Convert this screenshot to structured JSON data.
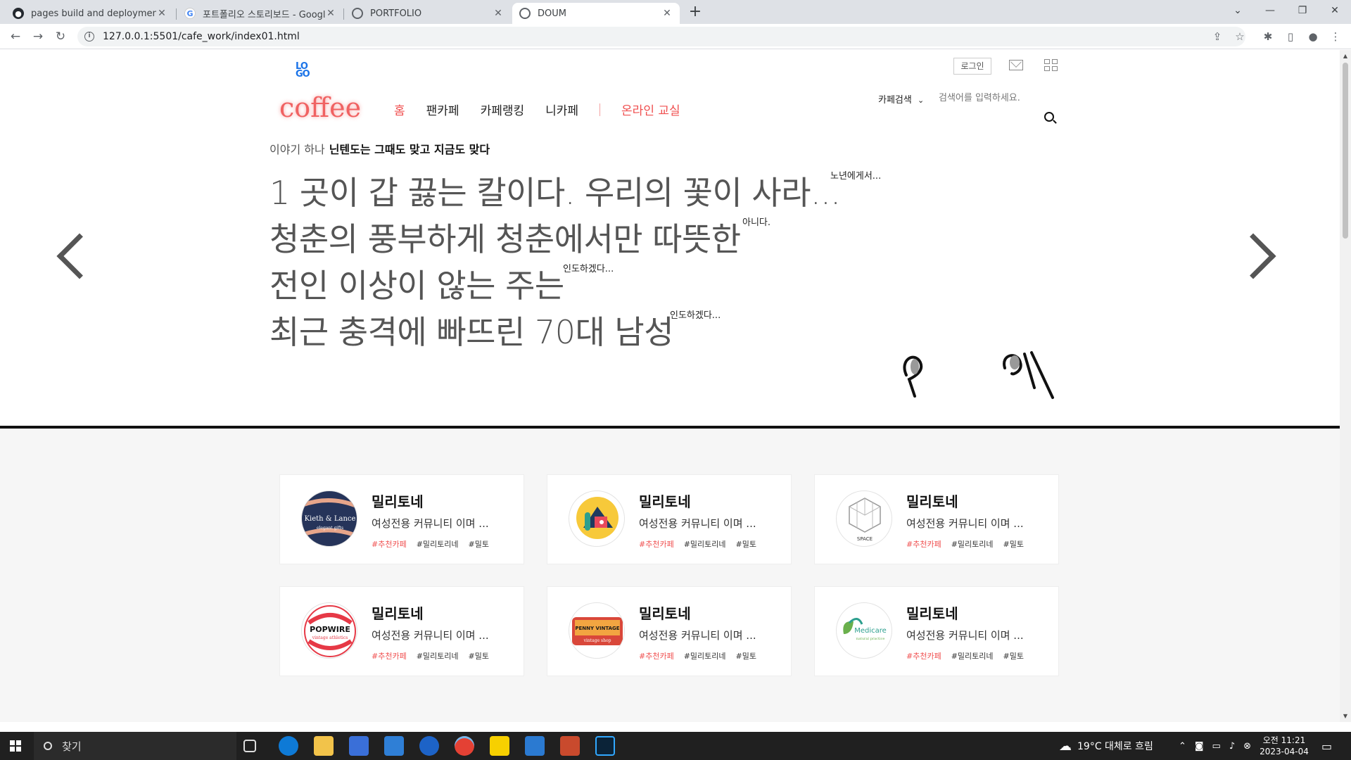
{
  "browser": {
    "tabs": [
      {
        "title": "pages build and deployment · w",
        "active": false,
        "favicon": "github-icon"
      },
      {
        "title": "포트폴리오 스토리보드 - Google",
        "active": false,
        "favicon": "google-icon"
      },
      {
        "title": "PORTFOLIO",
        "active": false,
        "favicon": "globe-icon"
      },
      {
        "title": "DOUM",
        "active": true,
        "favicon": "globe-icon"
      }
    ],
    "url": "127.0.0.1:5501/cafe_work/index01.html"
  },
  "header": {
    "logo_text": "LOGO",
    "brand": "coffee",
    "login_label": "로그인",
    "search_category": "카페검색",
    "search_placeholder": "검색어를 입력하세요."
  },
  "nav": {
    "items": [
      "홈",
      "팬카페",
      "카페랭킹",
      "니카페"
    ],
    "online": "온라인 교실"
  },
  "story": {
    "prefix": "이야기 하나",
    "headline": "닌텐도는 그때도 맞고 지금도 맞다"
  },
  "slides": [
    {
      "text": "1 곳이 갑 끓는 칼이다. 우리의 꽃이 사라...",
      "note": "노년에게서..."
    },
    {
      "text": "청춘의 풍부하게 청춘에서만 따뜻한",
      "note": "아니다."
    },
    {
      "text": "전인 이상이 않는 주는",
      "note": "인도하겠다..."
    },
    {
      "text": "최근 충격에 빠뜨린 70대 남성",
      "note": "인도하겠다..."
    }
  ],
  "cards": [
    {
      "name": "밀리토네",
      "desc": "여성전용 커뮤니티 이며 ...",
      "tags": [
        "#추천카페",
        "#밀리토리네",
        "#밀토"
      ],
      "logo_text": "Kieth & Lance",
      "logo_sub": "elegant gifts",
      "logo_bg": "#26345a"
    },
    {
      "name": "밀리토네",
      "desc": "여성전용 커뮤니티 이며 ...",
      "tags": [
        "#추천카페",
        "#밀리토리네",
        "#밀토"
      ],
      "logo_text": "",
      "logo_sub": "",
      "logo_bg": "#ffffff"
    },
    {
      "name": "밀리토네",
      "desc": "여성전용 커뮤니티 이며 ...",
      "tags": [
        "#추천카페",
        "#밀리토리네",
        "#밀토"
      ],
      "logo_text": "SPACE",
      "logo_sub": "",
      "logo_bg": "#ffffff"
    },
    {
      "name": "밀리토네",
      "desc": "여성전용 커뮤니티 이며 ...",
      "tags": [
        "#추천카페",
        "#밀리토리네",
        "#밀토"
      ],
      "logo_text": "POPWIRE",
      "logo_sub": "vintage athletics",
      "logo_bg": "#ffffff"
    },
    {
      "name": "밀리토네",
      "desc": "여성전용 커뮤니티 이며 ...",
      "tags": [
        "#추천카페",
        "#밀리토리네",
        "#밀토"
      ],
      "logo_text": "PENNY VINTAGE",
      "logo_sub": "vintage shop",
      "logo_bg": "#ffffff"
    },
    {
      "name": "밀리토네",
      "desc": "여성전용 커뮤니티 이며 ...",
      "tags": [
        "#추천카페",
        "#밀리토리네",
        "#밀토"
      ],
      "logo_text": "Medicare",
      "logo_sub": "natural practice",
      "logo_bg": "#ffffff"
    }
  ],
  "taskbar": {
    "search_label": "찾기",
    "weather": "19°C  대체로 흐림",
    "time": "오전 11:21",
    "date": "2023-04-04"
  },
  "colors": {
    "accent": "#f05050",
    "brand": "#f06262",
    "link": "#1a73e8"
  }
}
